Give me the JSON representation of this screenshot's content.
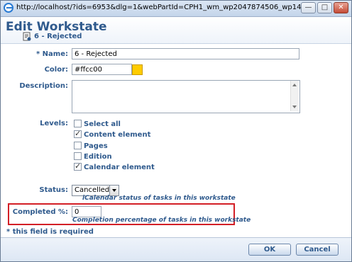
{
  "window": {
    "url": "http://localhost/?ids=6953&dlg=1&webPartId=CPH1_wm_wp2047874506_wp14030384...",
    "minimize_glyph": "—",
    "maximize_glyph": "□",
    "close_glyph": "✕"
  },
  "header": {
    "title": "Edit Workstate",
    "subtitle": "6 - Rejected"
  },
  "form": {
    "name": {
      "required_marker": "*",
      "label": "Name:",
      "value": "6 - Rejected"
    },
    "color": {
      "label": "Color:",
      "value": "#ffcc00",
      "swatch": "#ffcc00"
    },
    "description": {
      "label": "Description:",
      "value": ""
    },
    "levels": {
      "label": "Levels:",
      "options": [
        {
          "label": "Select all",
          "checked": false
        },
        {
          "label": "Content element",
          "checked": true
        },
        {
          "label": "Pages",
          "checked": false
        },
        {
          "label": "Edition",
          "checked": false
        },
        {
          "label": "Calendar element",
          "checked": true
        }
      ]
    },
    "status": {
      "label": "Status:",
      "selected": "Cancelled",
      "hint": "iCalendar status of tasks in this workstate"
    },
    "completed": {
      "label": "Completed %:",
      "value": "0",
      "hint": "Completion percentage of tasks in this workstate"
    },
    "required_note": "* this field is required"
  },
  "footer": {
    "ok_label": "OK",
    "cancel_label": "Cancel"
  }
}
